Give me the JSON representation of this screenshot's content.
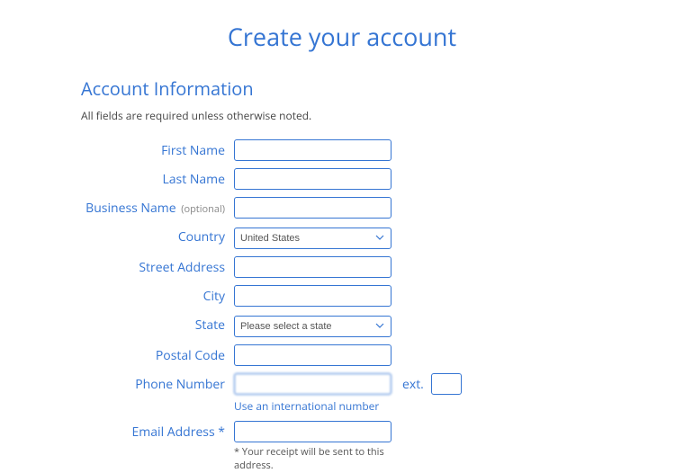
{
  "page_title": "Create your account",
  "section_heading": "Account Information",
  "required_note": "All fields are required unless otherwise noted.",
  "labels": {
    "first_name": "First Name",
    "last_name": "Last Name",
    "business_name": "Business Name",
    "business_name_optional": "(optional)",
    "country": "Country",
    "street_address": "Street Address",
    "city": "City",
    "state": "State",
    "postal_code": "Postal Code",
    "phone_number": "Phone Number",
    "ext": "ext.",
    "email_address": "Email Address *"
  },
  "values": {
    "first_name": "",
    "last_name": "",
    "business_name": "",
    "country_selected": "United States",
    "street_address": "",
    "city": "",
    "state_selected": "Please select a state",
    "postal_code": "",
    "phone_number": "",
    "phone_ext": "",
    "email_address": ""
  },
  "intl_link": "Use an international number",
  "receipt_note": "* Your receipt will be sent to this address."
}
